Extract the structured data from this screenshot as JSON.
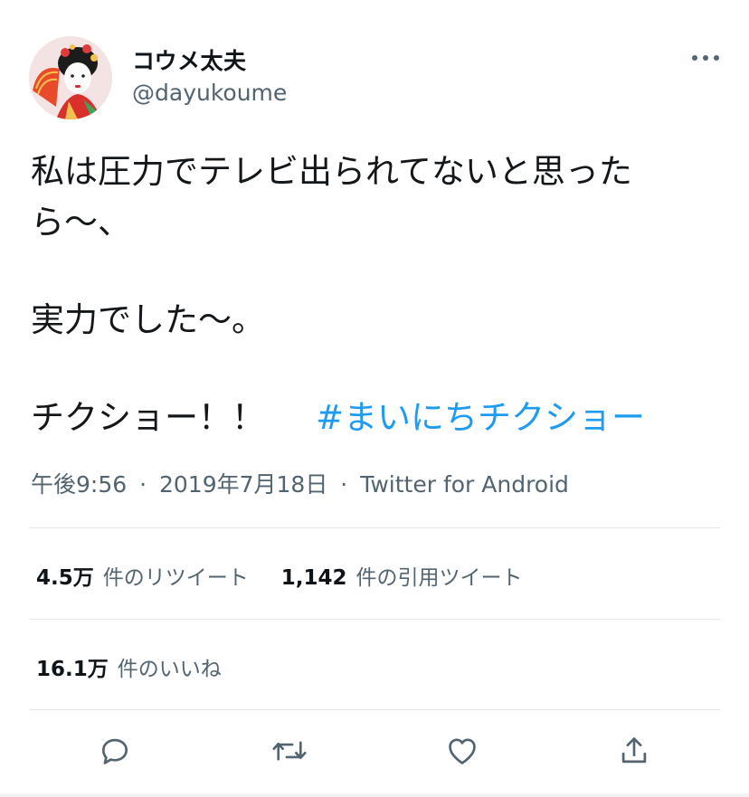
{
  "user": {
    "display_name": "コウメ太夫",
    "handle": "@dayukoume"
  },
  "tweet": {
    "lines": [
      "私は圧力でテレビ出られてないと思った",
      "ら〜、",
      "実力でした〜。",
      "チクショー！！"
    ],
    "hashtag": "#まいにちチクショー"
  },
  "meta": {
    "time": "午後9:56",
    "separator": "·",
    "date": "2019年7月18日",
    "source": "Twitter for Android"
  },
  "stats": {
    "retweets_count": "4.5万",
    "retweets_label": "件のリツイート",
    "quotes_count": "1,142",
    "quotes_label": "件の引用ツイート",
    "likes_count": "16.1万",
    "likes_label": "件のいいね"
  },
  "icons": {
    "more": "more-horizontal-icon",
    "reply": "reply-icon",
    "retweet": "retweet-icon",
    "like": "heart-icon",
    "share": "share-icon"
  },
  "colors": {
    "link": "#1d9bf0",
    "secondary": "#536471",
    "text": "#14171a",
    "divider": "#e6e9eb"
  }
}
